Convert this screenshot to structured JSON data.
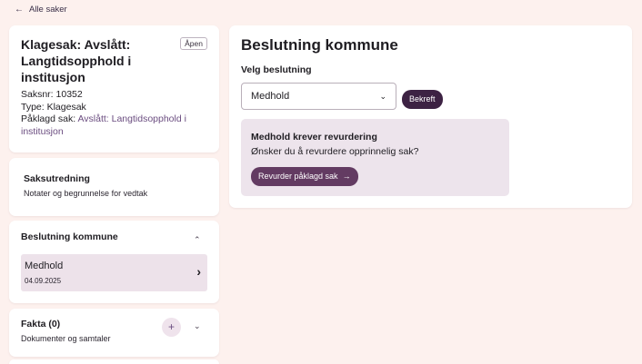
{
  "nav": {
    "back_icon": "arrow-left-icon",
    "back_arrow": "←",
    "back_label": "Alle saker"
  },
  "case": {
    "title": "Klagesak: Avslått: Langtidsopphold i institusjon",
    "status": "Åpen",
    "saksnr": "Saksnr: 10352",
    "type": "Type: Klagesak",
    "paaklagd_label": "Påklagd sak:",
    "paaklagd_link": "Avslått: Langtidsopphold i institusjon"
  },
  "utredning": {
    "title": "Saksutredning",
    "subtitle": "Notater og begrunnelse for vedtak"
  },
  "beslutning_list": {
    "title": "Beslutning kommune",
    "chevron": "⌃",
    "item": {
      "value": "Medhold",
      "date": "04.09.2025",
      "arrow": "›"
    }
  },
  "fakta": {
    "title": "Fakta (0)",
    "subtitle": "Dokumenter og samtaler",
    "plus": "+",
    "chevron": "⌄"
  },
  "main": {
    "title": "Beslutning kommune",
    "select_label": "Velg beslutning",
    "select_value": "Medhold",
    "select_caret": "⌄",
    "confirm_label": "Bekreft",
    "alert": {
      "heading": "Medhold krever revurdering",
      "question": "Ønsker du å revurdere opprinnelig sak?",
      "button_label": "Revurder påklagd sak",
      "button_arrow": "→"
    }
  },
  "colors": {
    "background": "#fdf1ee",
    "primary": "#3d2243",
    "accent": "#633b62",
    "highlight": "#ede2ea",
    "link": "#6b4d80"
  }
}
